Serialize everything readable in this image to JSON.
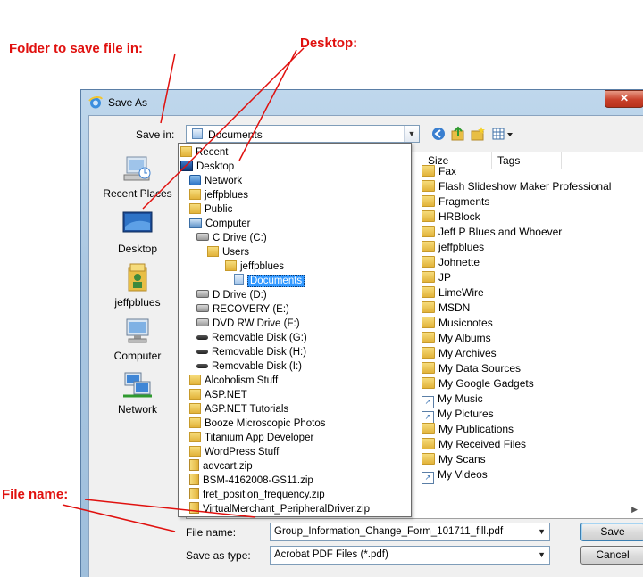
{
  "annotations": {
    "folder_to_save": "Folder to save file in:",
    "desktop": "Desktop:",
    "file_name": "File name:"
  },
  "window": {
    "title": "Save As",
    "close_glyph": "✕"
  },
  "save_in": {
    "label": "Save in:",
    "value": "Documents"
  },
  "places": [
    {
      "label": "Recent Places",
      "icon": "recent-places-icon"
    },
    {
      "label": "Desktop",
      "icon": "desktop-icon"
    },
    {
      "label": "jeffpblues",
      "icon": "user-folder-icon"
    },
    {
      "label": "Computer",
      "icon": "computer-icon"
    },
    {
      "label": "Network",
      "icon": "network-icon"
    }
  ],
  "columns": {
    "size": "Size",
    "tags": "Tags"
  },
  "files": [
    {
      "name": "Fax",
      "type": "folder"
    },
    {
      "name": "Flash Slideshow Maker Professional",
      "type": "folder"
    },
    {
      "name": "Fragments",
      "type": "folder"
    },
    {
      "name": "HRBlock",
      "type": "folder"
    },
    {
      "name": "Jeff P Blues and Whoever",
      "type": "folder"
    },
    {
      "name": "jeffpblues",
      "type": "folder"
    },
    {
      "name": "Johnette",
      "type": "folder"
    },
    {
      "name": "JP",
      "type": "folder"
    },
    {
      "name": "LimeWire",
      "type": "folder"
    },
    {
      "name": "MSDN",
      "type": "folder"
    },
    {
      "name": "Musicnotes",
      "type": "folder"
    },
    {
      "name": "My Albums",
      "type": "folder"
    },
    {
      "name": "My Archives",
      "type": "folder"
    },
    {
      "name": "My Data Sources",
      "type": "data-folder"
    },
    {
      "name": "My Google Gadgets",
      "type": "folder"
    },
    {
      "name": "My Music",
      "type": "shortcut"
    },
    {
      "name": "My Pictures",
      "type": "shortcut"
    },
    {
      "name": "My Publications",
      "type": "folder"
    },
    {
      "name": "My Received Files",
      "type": "folder"
    },
    {
      "name": "My Scans",
      "type": "folder"
    },
    {
      "name": "My Videos",
      "type": "shortcut"
    }
  ],
  "dropdown": [
    {
      "label": "Recent",
      "indent": 0,
      "icon": "f"
    },
    {
      "label": "Desktop",
      "indent": 0,
      "icon": "desk"
    },
    {
      "label": "Network",
      "indent": 1,
      "icon": "net"
    },
    {
      "label": "jeffpblues",
      "indent": 1,
      "icon": "f"
    },
    {
      "label": "Public",
      "indent": 1,
      "icon": "f"
    },
    {
      "label": "Computer",
      "indent": 1,
      "icon": "comp"
    },
    {
      "label": "C Drive (C:)",
      "indent": 2,
      "icon": "drive"
    },
    {
      "label": "Users",
      "indent": 3,
      "icon": "f"
    },
    {
      "label": "jeffpblues",
      "indent": 4,
      "icon": "f"
    },
    {
      "label": "Documents",
      "indent": 5,
      "icon": "doc",
      "selected": true
    },
    {
      "label": "D Drive (D:)",
      "indent": 2,
      "icon": "drive"
    },
    {
      "label": "RECOVERY (E:)",
      "indent": 2,
      "icon": "drive"
    },
    {
      "label": "DVD RW Drive (F:)",
      "indent": 2,
      "icon": "drive"
    },
    {
      "label": "Removable Disk (G:)",
      "indent": 2,
      "icon": "disk"
    },
    {
      "label": "Removable Disk (H:)",
      "indent": 2,
      "icon": "disk"
    },
    {
      "label": "Removable Disk (I:)",
      "indent": 2,
      "icon": "disk"
    },
    {
      "label": "Alcoholism Stuff",
      "indent": 1,
      "icon": "f"
    },
    {
      "label": "ASP.NET",
      "indent": 1,
      "icon": "f"
    },
    {
      "label": "ASP.NET Tutorials",
      "indent": 1,
      "icon": "f"
    },
    {
      "label": "Booze Microscopic Photos",
      "indent": 1,
      "icon": "f"
    },
    {
      "label": "Titanium App Developer",
      "indent": 1,
      "icon": "f"
    },
    {
      "label": "WordPress Stuff",
      "indent": 1,
      "icon": "f"
    },
    {
      "label": "advcart.zip",
      "indent": 1,
      "icon": "zip"
    },
    {
      "label": "BSM-4162008-GS11.zip",
      "indent": 1,
      "icon": "zip"
    },
    {
      "label": "fret_position_frequency.zip",
      "indent": 1,
      "icon": "zip"
    },
    {
      "label": "VirtualMerchant_PeripheralDriver.zip",
      "indent": 1,
      "icon": "zip"
    }
  ],
  "file_name": {
    "label": "File name:",
    "value": "Group_Information_Change_Form_101711_fill.pdf"
  },
  "save_as_type": {
    "label": "Save as type:",
    "value": "Acrobat PDF Files (*.pdf)"
  },
  "buttons": {
    "save": "Save",
    "cancel": "Cancel"
  }
}
